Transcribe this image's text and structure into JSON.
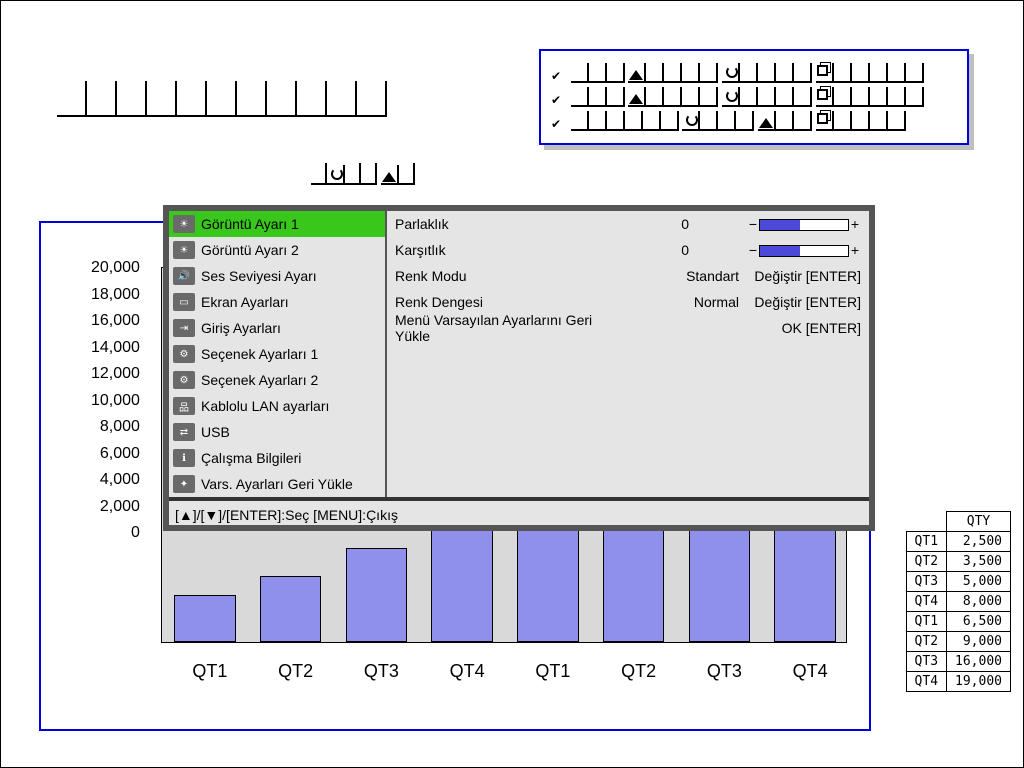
{
  "chart_data": {
    "type": "bar",
    "categories": [
      "QT1",
      "QT2",
      "QT3",
      "QT4",
      "QT1",
      "QT2",
      "QT3",
      "QT4"
    ],
    "values": [
      2500,
      3500,
      5000,
      8000,
      6500,
      9000,
      16000,
      19000
    ],
    "ylim": [
      0,
      20000
    ],
    "y_ticks": [
      20000,
      18000,
      16000,
      14000,
      12000,
      10000,
      8000,
      6000,
      4000,
      2000,
      0
    ],
    "y_tick_labels": [
      "20,000",
      "18,000",
      "16,000",
      "14,000",
      "12,000",
      "10,000",
      "8,000",
      "6,000",
      "4,000",
      "2,000",
      "0"
    ],
    "title": "",
    "xlabel": "",
    "ylabel": ""
  },
  "qty_table": {
    "header": "QTY",
    "rows": [
      {
        "k": "QT1",
        "v": "2,500"
      },
      {
        "k": "QT2",
        "v": "3,500"
      },
      {
        "k": "QT3",
        "v": "5,000"
      },
      {
        "k": "QT4",
        "v": "8,000"
      },
      {
        "k": "QT1",
        "v": "6,500"
      },
      {
        "k": "QT2",
        "v": "9,000"
      },
      {
        "k": "QT3",
        "v": "16,000"
      },
      {
        "k": "QT4",
        "v": "19,000"
      }
    ]
  },
  "osd": {
    "left": [
      "Görüntü Ayarı 1",
      "Görüntü Ayarı 2",
      "Ses Seviyesi Ayarı",
      "Ekran Ayarları",
      "Giriş Ayarları",
      "Seçenek Ayarları 1",
      "Seçenek Ayarları 2",
      "Kablolu LAN ayarları",
      "USB",
      "Çalışma Bilgileri",
      "Vars. Ayarları Geri Yükle"
    ],
    "right": {
      "brightness_lab": "Parlaklık",
      "brightness_val": "0",
      "contrast_lab": "Karşıtlık",
      "contrast_val": "0",
      "colormode_lab": "Renk Modu",
      "colormode_val": "Standart",
      "colormode_act": "Değiştir [ENTER]",
      "colorbal_lab": "Renk Dengesi",
      "colorbal_val": "Normal",
      "colorbal_act": "Değiştir [ENTER]",
      "reset_lab": "Menü Varsayılan Ayarlarını Geri Yükle",
      "reset_act": "OK [ENTER]"
    },
    "footer": "[▲]/[▼]/[ENTER]:Seç  [MENU]:Çıkış"
  }
}
